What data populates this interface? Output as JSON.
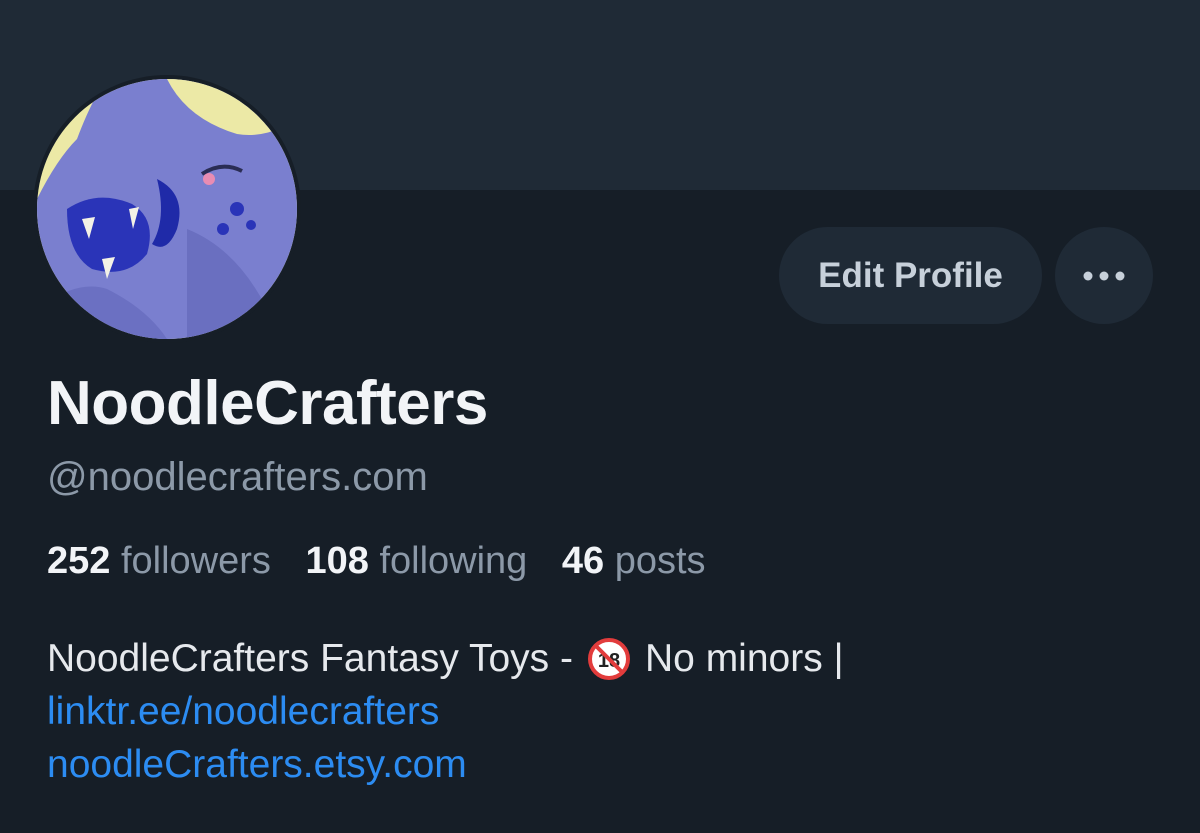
{
  "profile": {
    "display_name": "NoodleCrafters",
    "handle": "@noodlecrafters.com",
    "avatar": "dragon-character-avatar"
  },
  "actions": {
    "edit_label": "Edit Profile",
    "more_icon": "ellipsis-icon"
  },
  "stats": {
    "followers_count": "252",
    "followers_label": "followers",
    "following_count": "108",
    "following_label": "following",
    "posts_count": "46",
    "posts_label": "posts"
  },
  "bio": {
    "text_before": "NoodleCrafters Fantasy Toys -",
    "emoji": "no-one-under-18-icon",
    "text_after": "No minors |",
    "links": [
      "linktr.ee/noodlecrafters",
      "noodleCrafters.etsy.com"
    ]
  },
  "colors": {
    "background": "#161e27",
    "banner": "#1f2a36",
    "link": "#2c8cf2",
    "muted": "#8c99a8"
  }
}
